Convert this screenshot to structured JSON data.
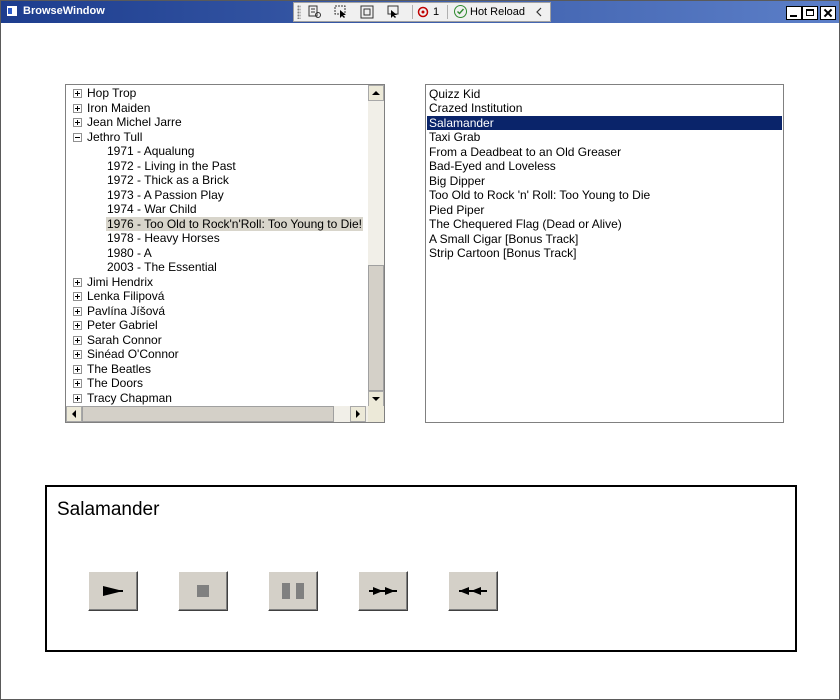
{
  "window": {
    "title": "BrowseWindow"
  },
  "debug_toolbar": {
    "binding_errors": "1",
    "hot_reload_label": "Hot Reload"
  },
  "tree": {
    "artists_before": [
      "Hop Trop",
      "Iron Maiden",
      "Jean Michel Jarre"
    ],
    "expanded_artist": "Jethro Tull",
    "albums": [
      "1971 - Aqualung",
      "1972 - Living in the Past",
      "1972 - Thick as a Brick",
      "1973 - A Passion Play",
      "1974 - War Child",
      "1976 - Too Old to Rock'n'Roll: Too Young to Die!",
      "1978 - Heavy Horses",
      "1980 - A",
      "2003 - The Essential"
    ],
    "selected_album": "1976 - Too Old to Rock'n'Roll: Too Young to Die!",
    "artists_after": [
      "Jimi Hendrix",
      "Lenka Filipová",
      "Pavlína Jíšová",
      "Peter Gabriel",
      "Sarah Connor",
      "Sinéad O'Connor",
      "The Beatles",
      "The Doors",
      "Tracy Chapman"
    ]
  },
  "tracks": {
    "items": [
      "Quizz Kid",
      "Crazed Institution",
      "Salamander",
      "Taxi Grab",
      "From a Deadbeat to an Old Greaser",
      "Bad-Eyed and Loveless",
      "Big Dipper",
      "Too Old to Rock 'n' Roll: Too Young to Die",
      "Pied Piper",
      "The Chequered Flag (Dead or Alive)",
      "A Small Cigar [Bonus Track]",
      "Strip Cartoon [Bonus Track]"
    ],
    "selected": "Salamander"
  },
  "player": {
    "now_playing": "Salamander"
  },
  "colors": {
    "selection": "#0a246a",
    "tree_selection": "#d8d5cb",
    "titlebar": "#1d3d8e"
  },
  "icons": [
    "play-icon",
    "stop-icon",
    "pause-icon",
    "fast-forward-icon",
    "rewind-icon"
  ]
}
